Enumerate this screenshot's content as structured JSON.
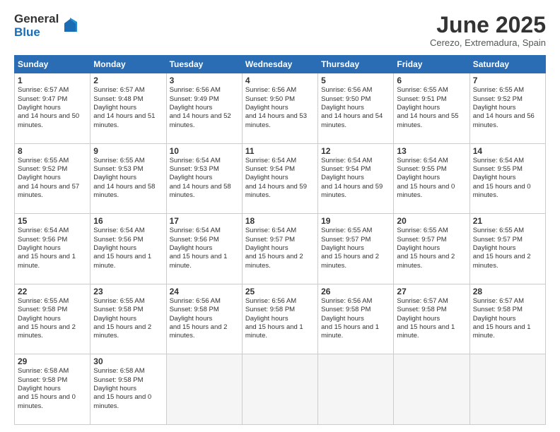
{
  "logo": {
    "general": "General",
    "blue": "Blue"
  },
  "title": "June 2025",
  "location": "Cerezo, Extremadura, Spain",
  "days": [
    "Sunday",
    "Monday",
    "Tuesday",
    "Wednesday",
    "Thursday",
    "Friday",
    "Saturday"
  ],
  "weeks": [
    [
      {
        "num": "1",
        "rise": "6:57 AM",
        "set": "9:47 PM",
        "daylight": "14 hours and 50 minutes."
      },
      {
        "num": "2",
        "rise": "6:57 AM",
        "set": "9:48 PM",
        "daylight": "14 hours and 51 minutes."
      },
      {
        "num": "3",
        "rise": "6:56 AM",
        "set": "9:49 PM",
        "daylight": "14 hours and 52 minutes."
      },
      {
        "num": "4",
        "rise": "6:56 AM",
        "set": "9:50 PM",
        "daylight": "14 hours and 53 minutes."
      },
      {
        "num": "5",
        "rise": "6:56 AM",
        "set": "9:50 PM",
        "daylight": "14 hours and 54 minutes."
      },
      {
        "num": "6",
        "rise": "6:55 AM",
        "set": "9:51 PM",
        "daylight": "14 hours and 55 minutes."
      },
      {
        "num": "7",
        "rise": "6:55 AM",
        "set": "9:52 PM",
        "daylight": "14 hours and 56 minutes."
      }
    ],
    [
      {
        "num": "8",
        "rise": "6:55 AM",
        "set": "9:52 PM",
        "daylight": "14 hours and 57 minutes."
      },
      {
        "num": "9",
        "rise": "6:55 AM",
        "set": "9:53 PM",
        "daylight": "14 hours and 58 minutes."
      },
      {
        "num": "10",
        "rise": "6:54 AM",
        "set": "9:53 PM",
        "daylight": "14 hours and 58 minutes."
      },
      {
        "num": "11",
        "rise": "6:54 AM",
        "set": "9:54 PM",
        "daylight": "14 hours and 59 minutes."
      },
      {
        "num": "12",
        "rise": "6:54 AM",
        "set": "9:54 PM",
        "daylight": "14 hours and 59 minutes."
      },
      {
        "num": "13",
        "rise": "6:54 AM",
        "set": "9:55 PM",
        "daylight": "15 hours and 0 minutes."
      },
      {
        "num": "14",
        "rise": "6:54 AM",
        "set": "9:55 PM",
        "daylight": "15 hours and 0 minutes."
      }
    ],
    [
      {
        "num": "15",
        "rise": "6:54 AM",
        "set": "9:56 PM",
        "daylight": "15 hours and 1 minute."
      },
      {
        "num": "16",
        "rise": "6:54 AM",
        "set": "9:56 PM",
        "daylight": "15 hours and 1 minute."
      },
      {
        "num": "17",
        "rise": "6:54 AM",
        "set": "9:56 PM",
        "daylight": "15 hours and 1 minute."
      },
      {
        "num": "18",
        "rise": "6:54 AM",
        "set": "9:57 PM",
        "daylight": "15 hours and 2 minutes."
      },
      {
        "num": "19",
        "rise": "6:55 AM",
        "set": "9:57 PM",
        "daylight": "15 hours and 2 minutes."
      },
      {
        "num": "20",
        "rise": "6:55 AM",
        "set": "9:57 PM",
        "daylight": "15 hours and 2 minutes."
      },
      {
        "num": "21",
        "rise": "6:55 AM",
        "set": "9:57 PM",
        "daylight": "15 hours and 2 minutes."
      }
    ],
    [
      {
        "num": "22",
        "rise": "6:55 AM",
        "set": "9:58 PM",
        "daylight": "15 hours and 2 minutes."
      },
      {
        "num": "23",
        "rise": "6:55 AM",
        "set": "9:58 PM",
        "daylight": "15 hours and 2 minutes."
      },
      {
        "num": "24",
        "rise": "6:56 AM",
        "set": "9:58 PM",
        "daylight": "15 hours and 2 minutes."
      },
      {
        "num": "25",
        "rise": "6:56 AM",
        "set": "9:58 PM",
        "daylight": "15 hours and 1 minute."
      },
      {
        "num": "26",
        "rise": "6:56 AM",
        "set": "9:58 PM",
        "daylight": "15 hours and 1 minute."
      },
      {
        "num": "27",
        "rise": "6:57 AM",
        "set": "9:58 PM",
        "daylight": "15 hours and 1 minute."
      },
      {
        "num": "28",
        "rise": "6:57 AM",
        "set": "9:58 PM",
        "daylight": "15 hours and 1 minute."
      }
    ],
    [
      {
        "num": "29",
        "rise": "6:58 AM",
        "set": "9:58 PM",
        "daylight": "15 hours and 0 minutes."
      },
      {
        "num": "30",
        "rise": "6:58 AM",
        "set": "9:58 PM",
        "daylight": "15 hours and 0 minutes."
      },
      null,
      null,
      null,
      null,
      null
    ]
  ]
}
